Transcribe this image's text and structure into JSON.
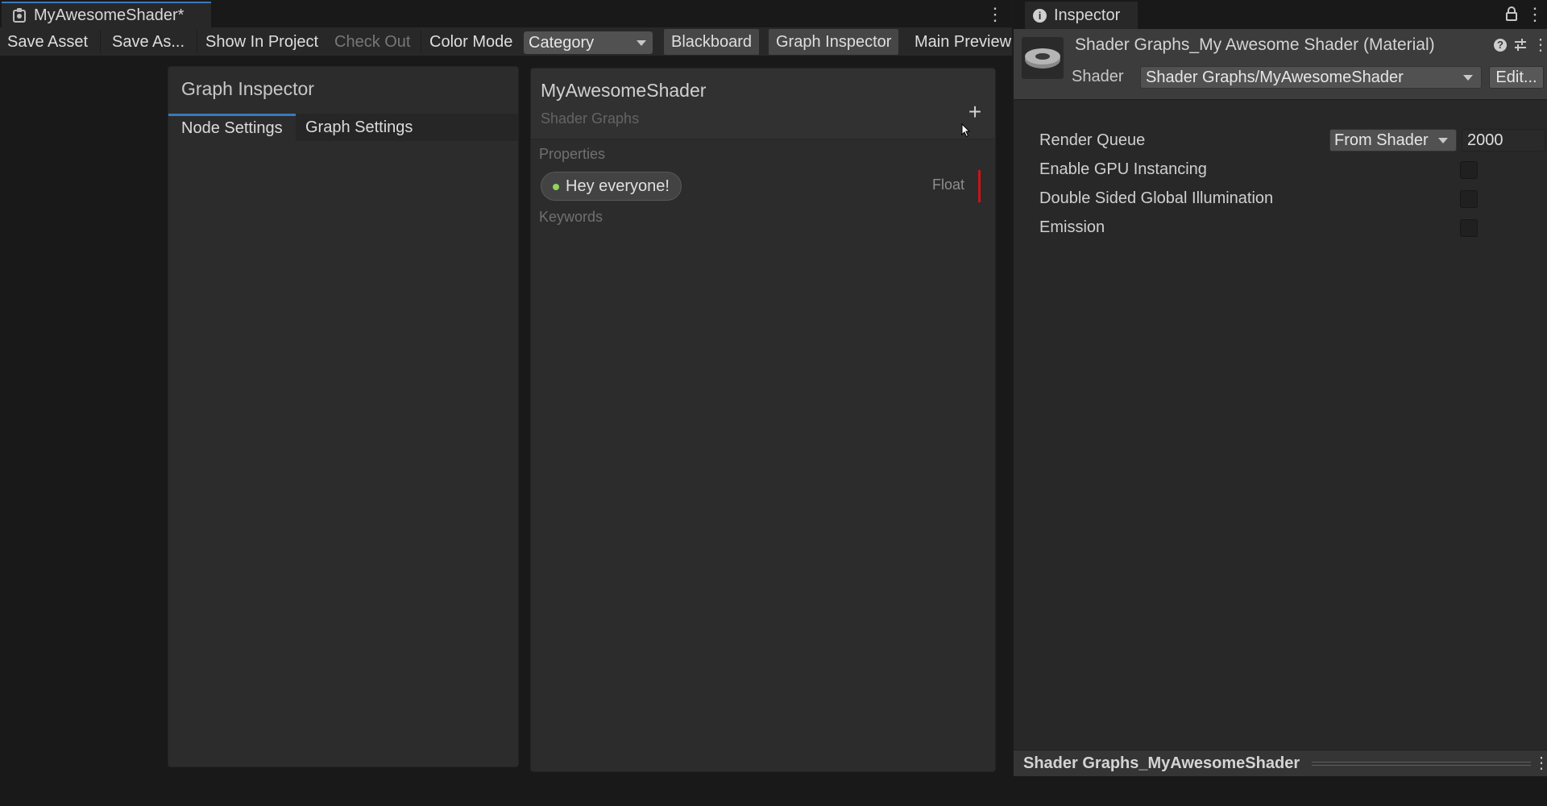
{
  "shader_graph_window": {
    "tab_title": "MyAwesomeShader*",
    "toolbar": {
      "save_asset": "Save Asset",
      "save_as": "Save As...",
      "show_in_project": "Show In Project",
      "check_out": "Check Out",
      "color_mode_label": "Color Mode",
      "color_mode_value": "Category",
      "blackboard": "Blackboard",
      "graph_inspector": "Graph Inspector",
      "main_preview": "Main Preview"
    },
    "graph_inspector": {
      "title": "Graph Inspector",
      "tabs": [
        "Node Settings",
        "Graph Settings"
      ],
      "active_tab": "Node Settings"
    },
    "blackboard": {
      "title": "MyAwesomeShader",
      "subtitle": "Shader Graphs",
      "add_icon": "plus-icon",
      "sections": {
        "properties": "Properties",
        "keywords": "Keywords"
      },
      "properties": [
        {
          "name": "Hey everyone!",
          "type": "Float",
          "dot_color": "#93d25e",
          "marker_color": "#c8141a"
        }
      ]
    }
  },
  "inspector_window": {
    "tab_title": "Inspector",
    "material_name": "Shader Graphs_My Awesome Shader (Material)",
    "shader_label": "Shader",
    "shader_value": "Shader Graphs/MyAwesomeShader",
    "edit_button": "Edit...",
    "properties": {
      "render_queue_label": "Render Queue",
      "render_queue_mode": "From Shader",
      "render_queue_value": "2000",
      "gpu_instancing_label": "Enable GPU Instancing",
      "gpu_instancing_checked": false,
      "double_sided_gi_label": "Double Sided Global Illumination",
      "double_sided_gi_checked": false,
      "emission_label": "Emission",
      "emission_checked": false
    },
    "footer_title": "Shader Graphs_MyAwesomeShader"
  },
  "colors": {
    "accent_blue": "#3a79bb",
    "panel_bg": "#2c2c2c",
    "window_bg": "#191919"
  }
}
